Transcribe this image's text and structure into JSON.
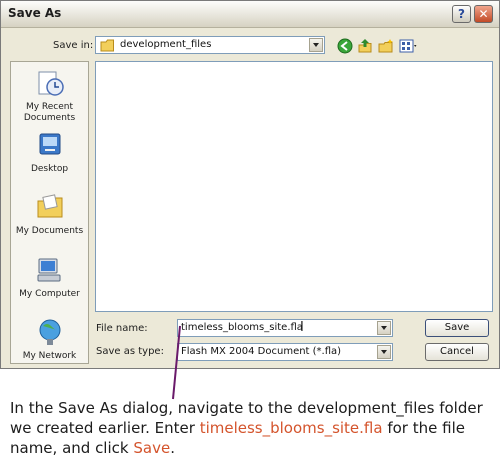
{
  "window": {
    "title": "Save As",
    "help_glyph": "?",
    "close_glyph": "✕"
  },
  "save_in": {
    "label": "Save in:",
    "value": "development_files"
  },
  "toolbar": {
    "icons": [
      "back-icon",
      "up-folder-icon",
      "new-folder-icon",
      "views-menu-icon"
    ]
  },
  "places": [
    {
      "label": "My Recent Documents",
      "icon": "recent-documents-icon"
    },
    {
      "label": "Desktop",
      "icon": "desktop-icon"
    },
    {
      "label": "My Documents",
      "icon": "my-documents-icon"
    },
    {
      "label": "My Computer",
      "icon": "my-computer-icon"
    },
    {
      "label": "My Network",
      "icon": "my-network-icon"
    }
  ],
  "file_name": {
    "label": "File name:",
    "value": "timeless_blooms_site.fla"
  },
  "save_as_type": {
    "label": "Save as type:",
    "value": "Flash MX 2004 Document (*.fla)"
  },
  "buttons": {
    "save": "Save",
    "cancel": "Cancel"
  },
  "caption": {
    "part1": "In the Save As dialog, navigate to the development_files folder we created earlier. Enter ",
    "filename": "timeless_blooms_site.fla",
    "part2": " for the file name, and click ",
    "save": "Save",
    "part3": "."
  },
  "colors": {
    "dialog_bg": "#ece9d8",
    "highlight": "#d4542c",
    "pointer_line": "#6a1a6a"
  }
}
